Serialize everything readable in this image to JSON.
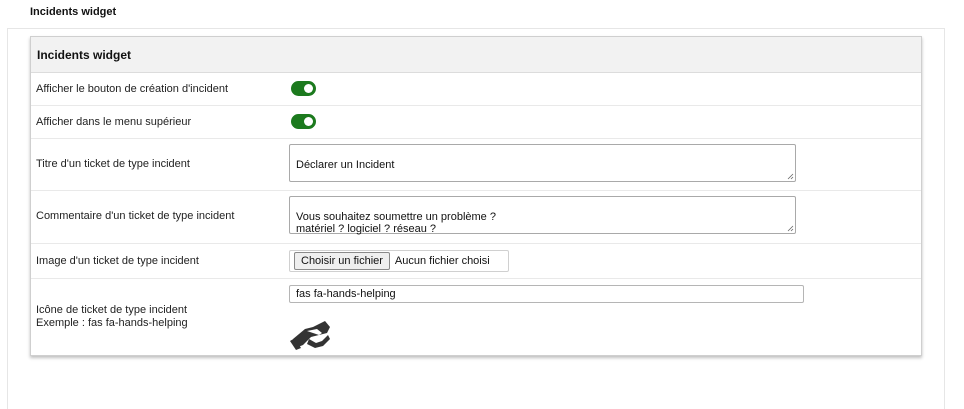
{
  "page": {
    "title": "Incidents widget"
  },
  "panel": {
    "title": "Incidents widget",
    "rows": {
      "show_create_button": {
        "label": "Afficher le bouton de création d'incident",
        "enabled": true
      },
      "show_top_menu": {
        "label": "Afficher dans le menu supérieur",
        "enabled": true
      },
      "ticket_title": {
        "label": "Titre d'un ticket de type incident",
        "value": "Déclarer un Incident"
      },
      "ticket_comment": {
        "label": "Commentaire d'un ticket de type incident",
        "value": "Vous souhaitez soumettre un problème ?\nmatériel ? logiciel ? réseau ?"
      },
      "ticket_image": {
        "label": "Image d'un ticket de type incident",
        "button_label": "Choisir un fichier",
        "status": "Aucun fichier choisi"
      },
      "ticket_icon": {
        "label_line1": "Icône de ticket de type incident",
        "label_line2": "Exemple : fas fa-hands-helping",
        "value": "fas fa-hands-helping",
        "preview_icon": "hands-helping-icon"
      }
    }
  },
  "colors": {
    "toggle_on": "#1c7a1e",
    "header_bg": "#f2f2f2",
    "icon": "#333333"
  }
}
